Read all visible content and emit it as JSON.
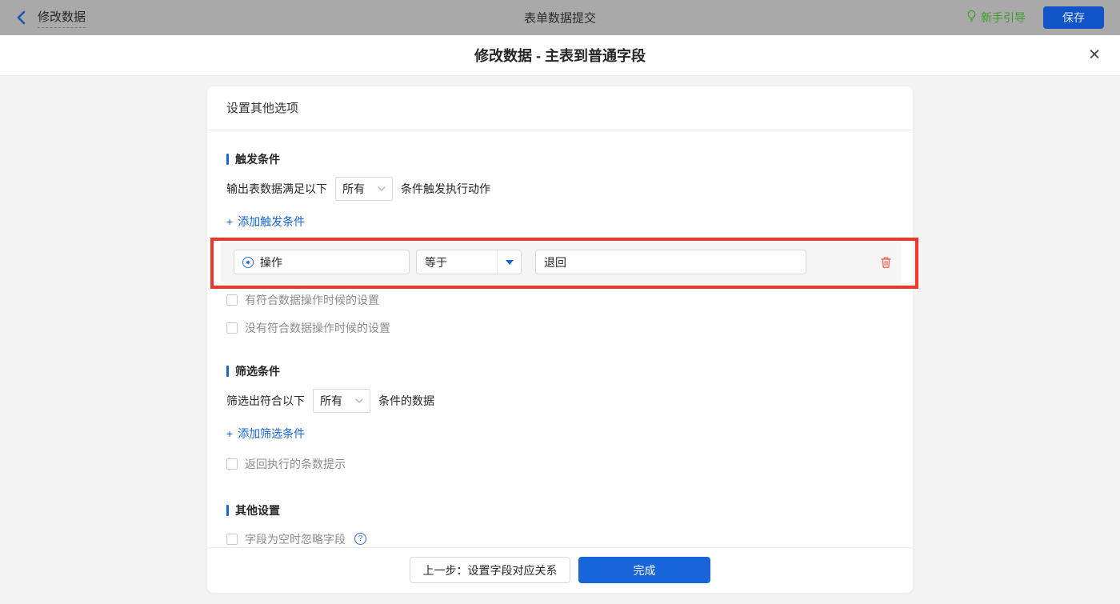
{
  "topbar": {
    "back_label": "修改数据",
    "title": "表单数据提交",
    "guide_label": "新手引导",
    "save_label": "保存"
  },
  "dialog": {
    "title": "修改数据 - 主表到普通字段",
    "close_glyph": "✕"
  },
  "panel": {
    "header": "设置其他选项",
    "trigger": {
      "title": "触发条件",
      "prefix": "输出表数据满足以下",
      "match_mode": "所有",
      "suffix": "条件触发执行动作",
      "add_plus": "+",
      "add_label": "添加触发条件",
      "row": {
        "field": "操作",
        "operator": "等于",
        "value": "退回"
      },
      "checkbox_has": "有符合数据操作时候的设置",
      "checkbox_none": "没有符合数据操作时候的设置"
    },
    "filter": {
      "title": "筛选条件",
      "prefix": "筛选出符合以下",
      "match_mode": "所有",
      "suffix": "条件的数据",
      "add_plus": "+",
      "add_label": "添加筛选条件",
      "checkbox_count": "返回执行的条数提示"
    },
    "other": {
      "title": "其他设置",
      "checkbox_empty": "字段为空时忽略字段",
      "help_glyph": "?"
    },
    "footer": {
      "prev_label": "上一步：设置字段对应关系",
      "finish_label": "完成"
    }
  },
  "colors": {
    "accent_blue": "#1765d9",
    "highlight_red": "#f2362b",
    "trash_red": "#f2594e",
    "guide_green": "#3d9e2d",
    "dimmed_bar": "#a9a9a9",
    "save_blue": "#1254c8",
    "row_bg": "#f5f5f5"
  }
}
